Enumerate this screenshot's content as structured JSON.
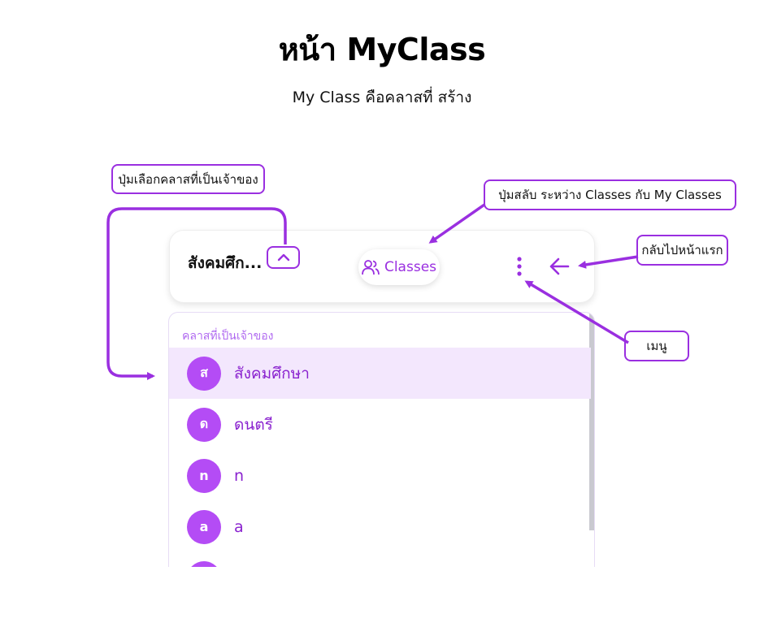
{
  "page": {
    "title": "หน้า MyClass",
    "subtitle": "My Class คือคลาสที่ สร้าง"
  },
  "callouts": {
    "owner_class_selector": "ปุ่มเลือกคลาสที่เป็นเจ้าของ",
    "toggle_classes": "ปุ่มสลับ ระหว่าง Classes กับ My Classes",
    "back_home": "กลับไปหน้าแรก",
    "menu": "เมนู"
  },
  "header": {
    "class_title": "สังคมศึก...",
    "classes_button_label": "Classes"
  },
  "panel": {
    "section_label": "คลาสที่เป็นเจ้าของ",
    "classes": [
      {
        "initial": "ส",
        "name": "สังคมศึกษา",
        "selected": true
      },
      {
        "initial": "ด",
        "name": "ดนตรี",
        "selected": false
      },
      {
        "initial": "n",
        "name": "n",
        "selected": false
      },
      {
        "initial": "a",
        "name": "a",
        "selected": false
      }
    ]
  },
  "icons": {
    "chevron": "chevron-up-icon",
    "classes": "users-icon",
    "menu": "more-vertical-icon",
    "back": "arrow-left-icon"
  },
  "colors": {
    "accent": "#9a2fe0",
    "avatar": "#b44cf5",
    "selected_row": "#f3e7fd",
    "section_label": "#b06af0"
  }
}
